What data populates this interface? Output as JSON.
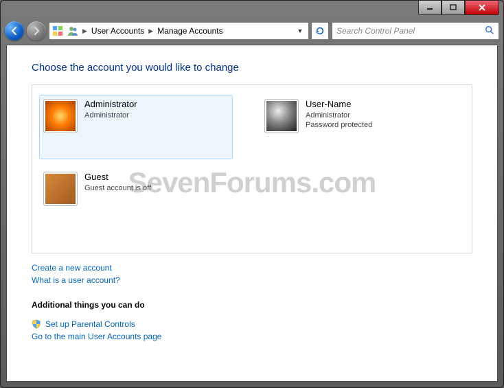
{
  "breadcrumb": {
    "item1": "User Accounts",
    "item2": "Manage Accounts"
  },
  "search": {
    "placeholder": "Search Control Panel"
  },
  "heading": "Choose the account you would like to change",
  "accounts": {
    "admin": {
      "name": "Administrator",
      "role": "Administrator"
    },
    "user": {
      "name": "User-Name",
      "role": "Administrator",
      "status": "Password protected"
    },
    "guest": {
      "name": "Guest",
      "role": "Guest account is off"
    }
  },
  "links": {
    "create": "Create a new account",
    "what": "What is a user account?"
  },
  "additional": {
    "title": "Additional things you can do",
    "parental": "Set up Parental Controls",
    "main": "Go to the main User Accounts page"
  },
  "watermark": "SevenForums.com"
}
